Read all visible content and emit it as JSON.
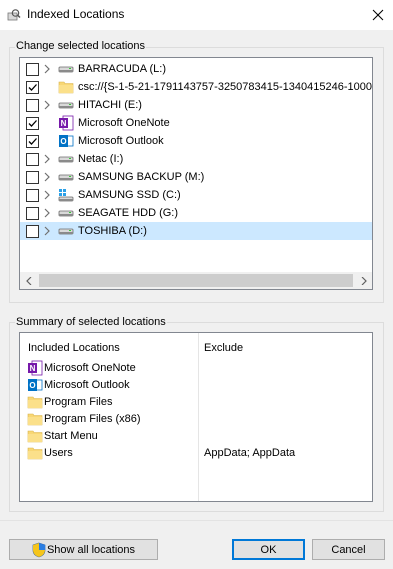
{
  "window": {
    "title": "Indexed Locations"
  },
  "colors": {
    "selection": "#cce8ff",
    "accent": "#0078d7",
    "folder": "#f8d775",
    "onenote": "#7719aa",
    "outlook": "#0072c6"
  },
  "change_group": {
    "label": "Change selected locations",
    "items": [
      {
        "label": "BARRACUDA (L:)",
        "checked": false,
        "expandable": true,
        "icon": "drive-icon",
        "selected": false
      },
      {
        "label": "csc://{S-1-5-21-1791143757-3250783415-1340415246-1000",
        "checked": true,
        "expandable": false,
        "icon": "folder-icon",
        "selected": false
      },
      {
        "label": "HITACHI (E:)",
        "checked": false,
        "expandable": true,
        "icon": "drive-icon",
        "selected": false
      },
      {
        "label": "Microsoft OneNote",
        "checked": true,
        "expandable": false,
        "icon": "onenote-icon",
        "selected": false
      },
      {
        "label": "Microsoft Outlook",
        "checked": true,
        "expandable": false,
        "icon": "outlook-icon",
        "selected": false
      },
      {
        "label": "Netac (I:)",
        "checked": false,
        "expandable": true,
        "icon": "drive-icon",
        "selected": false
      },
      {
        "label": "SAMSUNG BACKUP (M:)",
        "checked": false,
        "expandable": true,
        "icon": "drive-icon",
        "selected": false
      },
      {
        "label": "SAMSUNG SSD (C:)",
        "checked": false,
        "expandable": true,
        "icon": "windows-drive-icon",
        "selected": false
      },
      {
        "label": "SEAGATE HDD (G:)",
        "checked": false,
        "expandable": true,
        "icon": "drive-icon",
        "selected": false
      },
      {
        "label": "TOSHIBA (D:)",
        "checked": false,
        "expandable": true,
        "icon": "drive-icon",
        "selected": true
      }
    ]
  },
  "summary_group": {
    "label": "Summary of selected locations",
    "col_included": "Included Locations",
    "col_exclude": "Exclude",
    "rows": [
      {
        "label": "Microsoft OneNote",
        "icon": "onenote-icon",
        "exclude": ""
      },
      {
        "label": "Microsoft Outlook",
        "icon": "outlook-icon",
        "exclude": ""
      },
      {
        "label": "Program Files",
        "icon": "folder-icon",
        "exclude": ""
      },
      {
        "label": "Program Files (x86)",
        "icon": "folder-icon",
        "exclude": ""
      },
      {
        "label": "Start Menu",
        "icon": "folder-icon",
        "exclude": ""
      },
      {
        "label": "Users",
        "icon": "folder-icon",
        "exclude": "AppData; AppData"
      }
    ]
  },
  "buttons": {
    "show_all": "Show all locations",
    "ok": "OK",
    "cancel": "Cancel"
  }
}
